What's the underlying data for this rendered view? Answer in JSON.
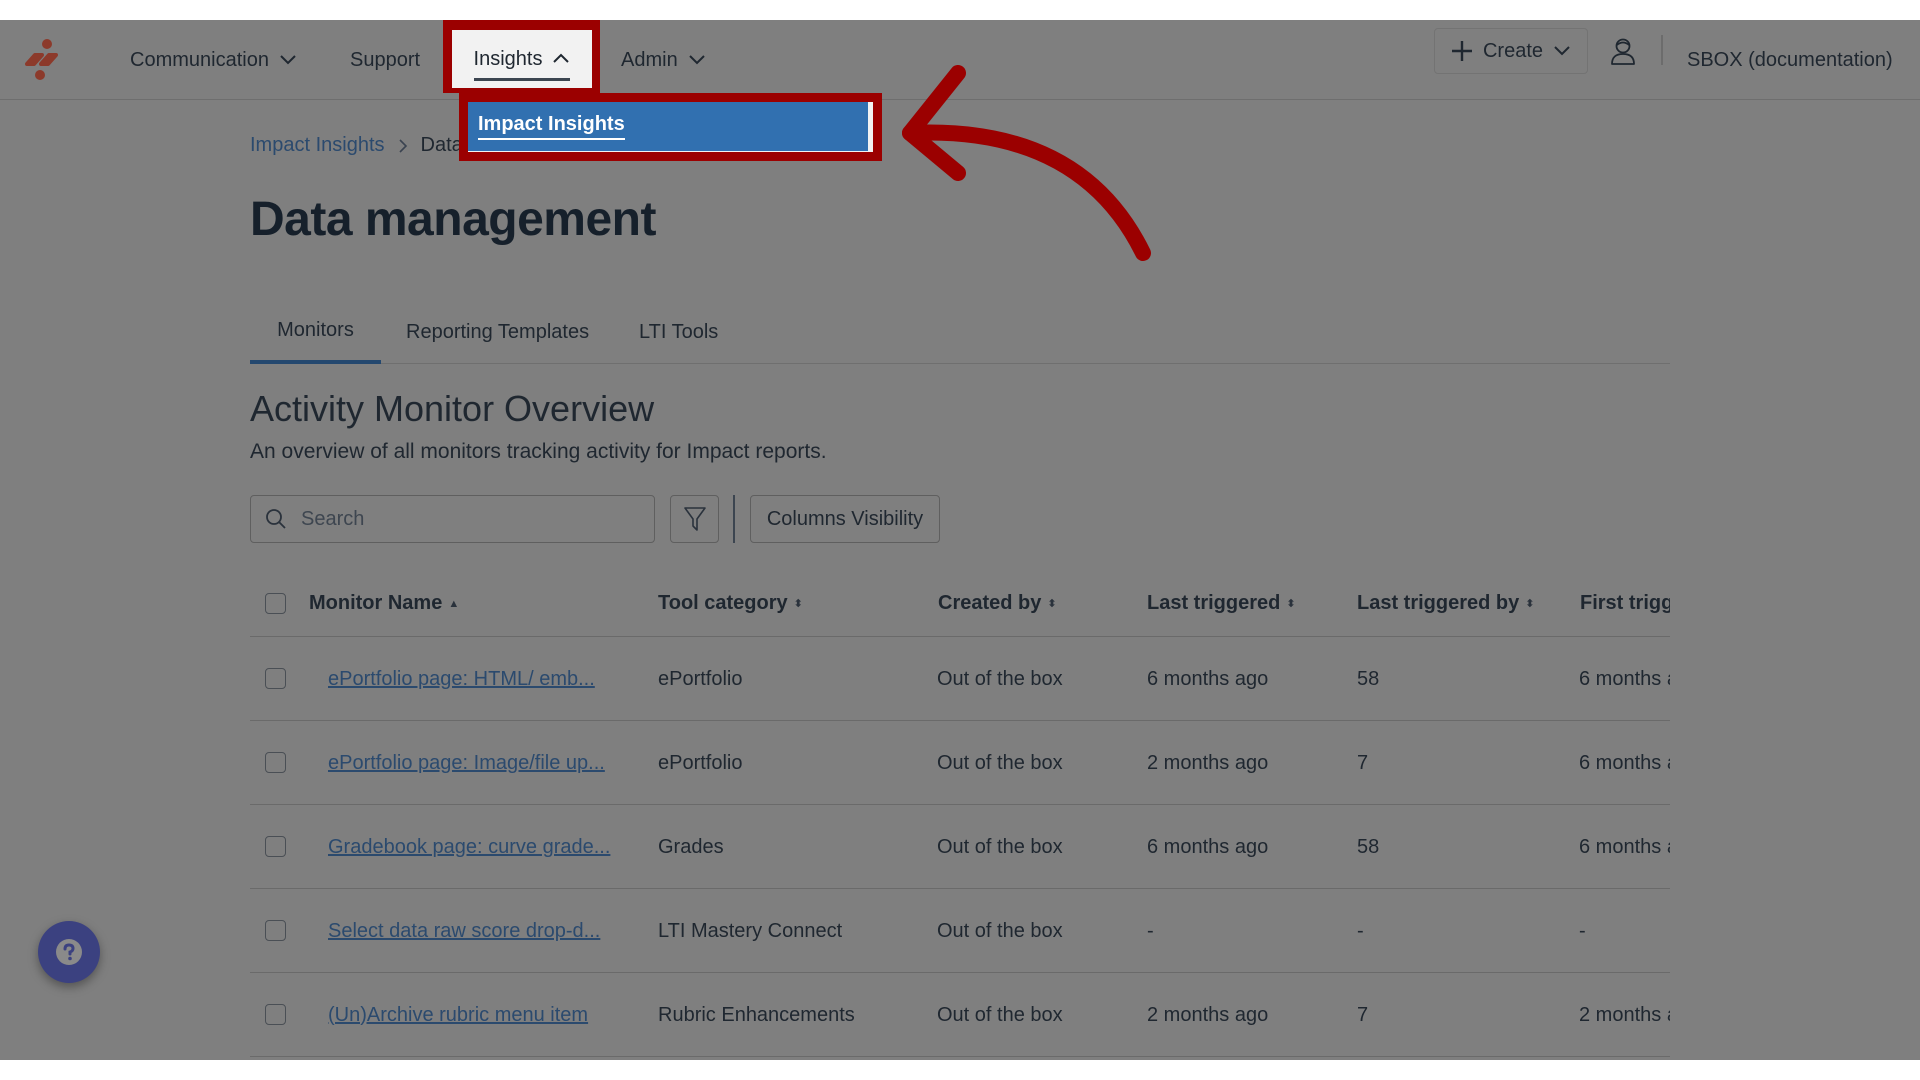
{
  "header": {
    "nav": [
      {
        "label": "Communication",
        "has_dropdown": true
      },
      {
        "label": "Support",
        "has_dropdown": false
      },
      {
        "label": "Insights",
        "has_dropdown": true,
        "expanded": true
      },
      {
        "label": "Admin",
        "has_dropdown": true
      }
    ],
    "create_label": "Create",
    "account_name": "SBOX (documentation)"
  },
  "dropdown": {
    "items": [
      {
        "label": "Impact Insights",
        "highlighted": true
      }
    ]
  },
  "breadcrumb": {
    "parent": "Impact Insights",
    "current": "Data management"
  },
  "page": {
    "title": "Data management",
    "tabs": [
      {
        "label": "Monitors",
        "active": true
      },
      {
        "label": "Reporting Templates",
        "active": false
      },
      {
        "label": "LTI Tools",
        "active": false
      }
    ],
    "section_title": "Activity Monitor Overview",
    "section_desc": "An overview of all monitors tracking activity for Impact reports.",
    "search_placeholder": "Search",
    "search_value": "",
    "columns_visibility_label": "Columns Visibility"
  },
  "table": {
    "columns": [
      {
        "label": "Monitor Name",
        "sort": "asc"
      },
      {
        "label": "Tool category",
        "sort": "both"
      },
      {
        "label": "Created by",
        "sort": "both"
      },
      {
        "label": "Last triggered",
        "sort": "both"
      },
      {
        "label": "Last triggered by",
        "sort": "both"
      },
      {
        "label": "First trigg",
        "sort": "none"
      }
    ],
    "rows": [
      {
        "name": "ePortfolio page: HTML/ emb...",
        "category": "ePortfolio",
        "created_by": "Out of the box",
        "last_triggered": "6 months ago",
        "last_triggered_by": "58",
        "first_triggered": "6 months a"
      },
      {
        "name": "ePortfolio page: Image/file up...",
        "category": "ePortfolio",
        "created_by": "Out of the box",
        "last_triggered": "2 months ago",
        "last_triggered_by": "7",
        "first_triggered": "6 months a"
      },
      {
        "name": "Gradebook page: curve grade...",
        "category": "Grades",
        "created_by": "Out of the box",
        "last_triggered": "6 months ago",
        "last_triggered_by": "58",
        "first_triggered": "6 months a"
      },
      {
        "name": "Select data raw score drop-d...",
        "category": "LTI Mastery Connect",
        "created_by": "Out of the box",
        "last_triggered": "-",
        "last_triggered_by": "-",
        "first_triggered": "-"
      },
      {
        "name": "(Un)Archive rubric menu item",
        "category": "Rubric Enhancements",
        "created_by": "Out of the box",
        "last_triggered": "2 months ago",
        "last_triggered_by": "7",
        "first_triggered": "2 months a"
      }
    ]
  },
  "annotation": {
    "highlight_color": "#9b0000",
    "arrow_color": "#9b0000"
  },
  "icons": {
    "logo": "brand-logo",
    "help": "question-icon",
    "search": "search-icon",
    "filter": "filter-icon",
    "user": "user-icon",
    "create": "plus-icon"
  }
}
